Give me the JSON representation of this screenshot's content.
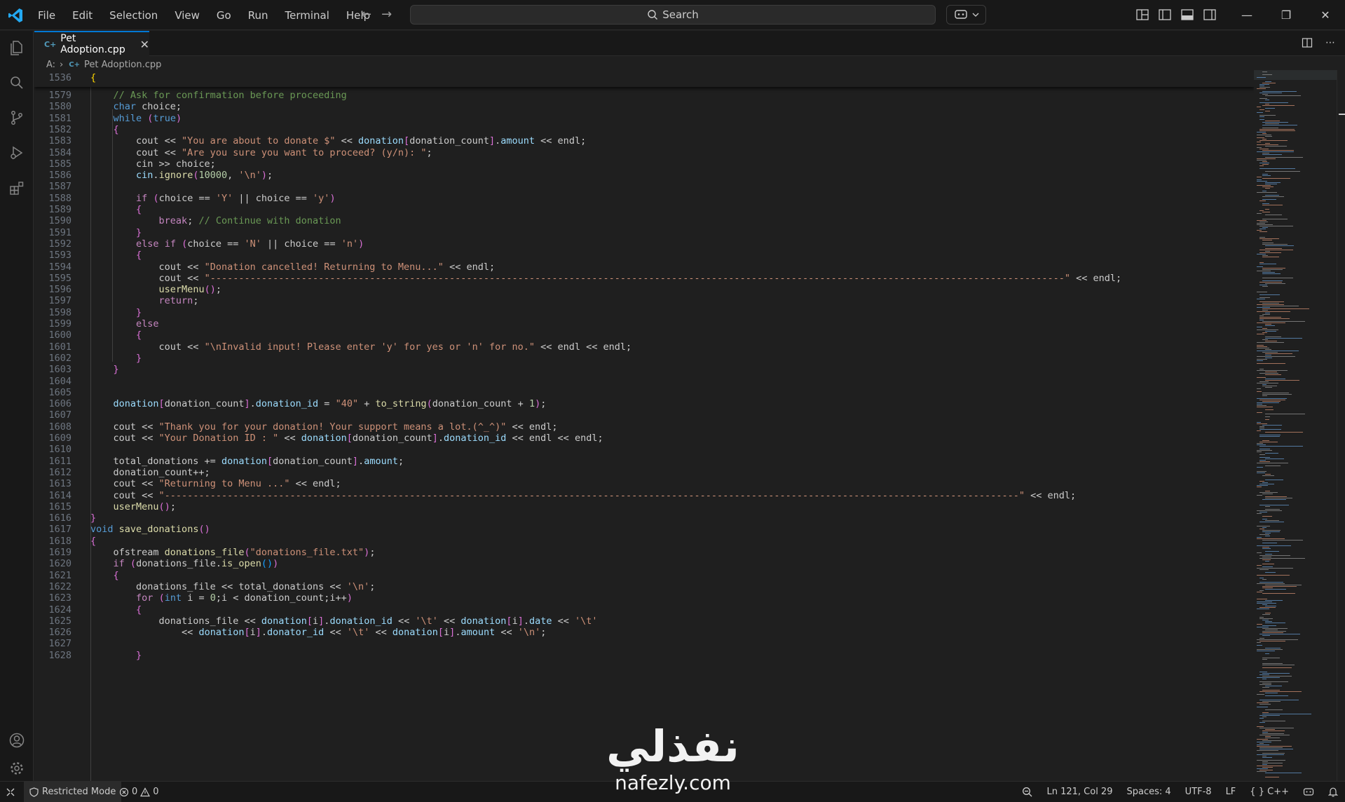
{
  "menu": [
    "File",
    "Edit",
    "Selection",
    "View",
    "Go",
    "Run",
    "Terminal",
    "Help"
  ],
  "search": {
    "label": "Search"
  },
  "tab": {
    "label": "Pet Adoption.cpp",
    "lang_badge": "C++"
  },
  "breadcrumb": {
    "drive": "A:",
    "file": "Pet Adoption.cpp"
  },
  "sticky": {
    "line_number": "1536",
    "code": "{"
  },
  "lines": [
    {
      "n": "1579",
      "code": "    // Ask for confirmation before proceeding"
    },
    {
      "n": "1580",
      "code": "    char choice;"
    },
    {
      "n": "1581",
      "code": "    while (true)"
    },
    {
      "n": "1582",
      "code": "    {"
    },
    {
      "n": "1583",
      "code": "        cout << \"You are about to donate $\" << donation[donation_count].amount << endl;"
    },
    {
      "n": "1584",
      "code": "        cout << \"Are you sure you want to proceed? (y/n): \";"
    },
    {
      "n": "1585",
      "code": "        cin >> choice;"
    },
    {
      "n": "1586",
      "code": "        cin.ignore(10000, '\\n');"
    },
    {
      "n": "1587",
      "code": ""
    },
    {
      "n": "1588",
      "code": "        if (choice == 'Y' || choice == 'y')"
    },
    {
      "n": "1589",
      "code": "        {"
    },
    {
      "n": "1590",
      "code": "            break; // Continue with donation"
    },
    {
      "n": "1591",
      "code": "        }"
    },
    {
      "n": "1592",
      "code": "        else if (choice == 'N' || choice == 'n')"
    },
    {
      "n": "1593",
      "code": "        {"
    },
    {
      "n": "1594",
      "code": "            cout << \"Donation cancelled! Returning to Menu...\" << endl;"
    },
    {
      "n": "1595",
      "code": "            cout << \"------------------------------------------------------------------------------------------------------------------------------------------------------\" << endl;"
    },
    {
      "n": "1596",
      "code": "            userMenu();"
    },
    {
      "n": "1597",
      "code": "            return;"
    },
    {
      "n": "1598",
      "code": "        }"
    },
    {
      "n": "1599",
      "code": "        else"
    },
    {
      "n": "1600",
      "code": "        {"
    },
    {
      "n": "1601",
      "code": "            cout << \"\\nInvalid input! Please enter 'y' for yes or 'n' for no.\" << endl << endl;"
    },
    {
      "n": "1602",
      "code": "        }"
    },
    {
      "n": "1603",
      "code": "    }"
    },
    {
      "n": "1604",
      "code": ""
    },
    {
      "n": "1605",
      "code": ""
    },
    {
      "n": "1606",
      "code": "    donation[donation_count].donation_id = \"40\" + to_string(donation_count + 1);"
    },
    {
      "n": "1607",
      "code": ""
    },
    {
      "n": "1608",
      "code": "    cout << \"Thank you for your donation! Your support means a lot.(^_^)\" << endl;"
    },
    {
      "n": "1609",
      "code": "    cout << \"Your Donation ID : \" << donation[donation_count].donation_id << endl << endl;"
    },
    {
      "n": "1610",
      "code": ""
    },
    {
      "n": "1611",
      "code": "    total_donations += donation[donation_count].amount;"
    },
    {
      "n": "1612",
      "code": "    donation_count++;"
    },
    {
      "n": "1613",
      "code": "    cout << \"Returning to Menu ...\" << endl;"
    },
    {
      "n": "1614",
      "code": "    cout << \"------------------------------------------------------------------------------------------------------------------------------------------------------\" << endl;"
    },
    {
      "n": "1615",
      "code": "    userMenu();"
    },
    {
      "n": "1616",
      "code": "}"
    },
    {
      "n": "1617",
      "code": "void save_donations()"
    },
    {
      "n": "1618",
      "code": "{"
    },
    {
      "n": "1619",
      "code": "    ofstream donations_file(\"donations_file.txt\");"
    },
    {
      "n": "1620",
      "code": "    if (donations_file.is_open())"
    },
    {
      "n": "1621",
      "code": "    {"
    },
    {
      "n": "1622",
      "code": "        donations_file << total_donations << '\\n';"
    },
    {
      "n": "1623",
      "code": "        for (int i = 0;i < donation_count;i++)"
    },
    {
      "n": "1624",
      "code": "        {"
    },
    {
      "n": "1625",
      "code": "            donations_file << donation[i].donation_id << '\\t' << donation[i].date << '\\t'"
    },
    {
      "n": "1626",
      "code": "                << donation[i].donator_id << '\\t' << donation[i].amount << '\\n';"
    },
    {
      "n": "1627",
      "code": ""
    },
    {
      "n": "1628",
      "code": "        }"
    }
  ],
  "status": {
    "restricted": "Restricted Mode",
    "errors": "0",
    "warnings": "0",
    "position": "Ln 121, Col 29",
    "spaces": "Spaces: 4",
    "encoding": "UTF-8",
    "eol": "LF",
    "language": "C++"
  },
  "watermark": {
    "arabic": "نفذلي",
    "latin": "nafezly.com"
  },
  "colors": {
    "accent": "#0078d4",
    "keyword": "#569cd6",
    "string": "#ce9178",
    "comment": "#6a9955",
    "function": "#dcdcaa",
    "variable": "#9cdcfe"
  }
}
